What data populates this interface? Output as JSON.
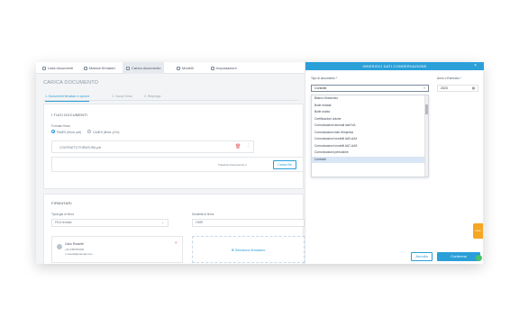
{
  "tabs": [
    {
      "label": "Lista documenti",
      "icon": "list-icon"
    },
    {
      "label": "Matrice firmatari",
      "icon": "matrix-icon"
    },
    {
      "label": "Carica documento",
      "icon": "upload-icon"
    },
    {
      "label": "Modelli",
      "icon": "template-icon"
    },
    {
      "label": "Impostazioni",
      "icon": "settings-icon"
    }
  ],
  "left": {
    "title": "CARICA DOCUMENTO",
    "steps": [
      "1. Documenti firmatari e opzioni",
      "2. Campi firma",
      "3. Riepilogo"
    ],
    "documents": {
      "section": "I TUOI DOCUMENTI",
      "sign_label": "Formato firma",
      "radio_1": "PAdES (firma .pdf)",
      "radio_2": "CAdES (firma .p7m)",
      "file_name": "CONTRATTO FORNITURA.pdf",
      "drop_text": "Trascina il documento o",
      "upload_button": "Carica file"
    },
    "signers": {
      "section": "FIRMATARI",
      "type_label": "Tipologia di firma",
      "type_value": "FEA remota",
      "mode_label": "Modalità di firma",
      "mode_value": "OMR",
      "name": "Carlo Rossetti",
      "phone": "+39 3456782345",
      "email": "c.rossetti@example.com",
      "add_signer": "Seleziona firmatario"
    }
  },
  "modal": {
    "title": "INSERISCI DATI CONSERVAZIONE",
    "close": "×",
    "type_label": "Tipo di documento *",
    "type_value": "Contratti",
    "year_label": "Anno o Esercizio *",
    "year_value": "2023",
    "options": [
      "Bilanci d'esercizio",
      "Bolle entrata",
      "Bolle uscita",
      "Certificazioni uniche",
      "Comunicazioni annuali dati IVA",
      "Comunicazioni dati d'impresa",
      "Comunicazioni modelli AA9-AA4",
      "Comunicazioni modelli AA7-AA9",
      "Comunicazioni periodiche",
      "Contratti"
    ],
    "selected_option": "Contratti",
    "cancel": "Annulla",
    "confirm": "Conferma"
  },
  "help_badge": "Help",
  "colors": {
    "accent": "#2a9fd8",
    "help": "#f5a623",
    "confirm": "#2a9fd8"
  }
}
